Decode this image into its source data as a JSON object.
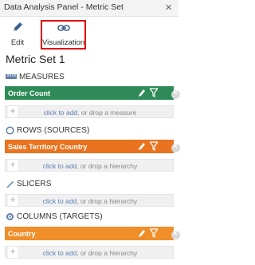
{
  "window": {
    "title": "Data Analysis Panel - Metric Set",
    "close_glyph": "×"
  },
  "toolbar": {
    "edit_label": "Edit",
    "viz_label": "Visualization"
  },
  "heading": "Metric Set 1",
  "sections": {
    "measures": {
      "label": "MEASURES",
      "item": "Order Count",
      "drop_link": "click to add",
      "drop_rest": ", or drop a measure"
    },
    "rows": {
      "label": "ROWS (SOURCES)",
      "item": "Sales Territory Country",
      "drop_link": "click to add",
      "drop_rest": ", or drop a hierarchy"
    },
    "slicers": {
      "label": "SLICERS",
      "drop_link": "click to add",
      "drop_rest": ", or drop a hierarchy"
    },
    "columns": {
      "label": "COLUMNS (TARGETS)",
      "item": "Country",
      "drop_link": "click to add",
      "drop_rest": ", or drop a hierarchy"
    }
  },
  "colors": {
    "measure_bar": "#2e8b57",
    "rows_bar": "#e9731f",
    "columns_bar": "#f08e2a",
    "highlight": "#e10000"
  }
}
